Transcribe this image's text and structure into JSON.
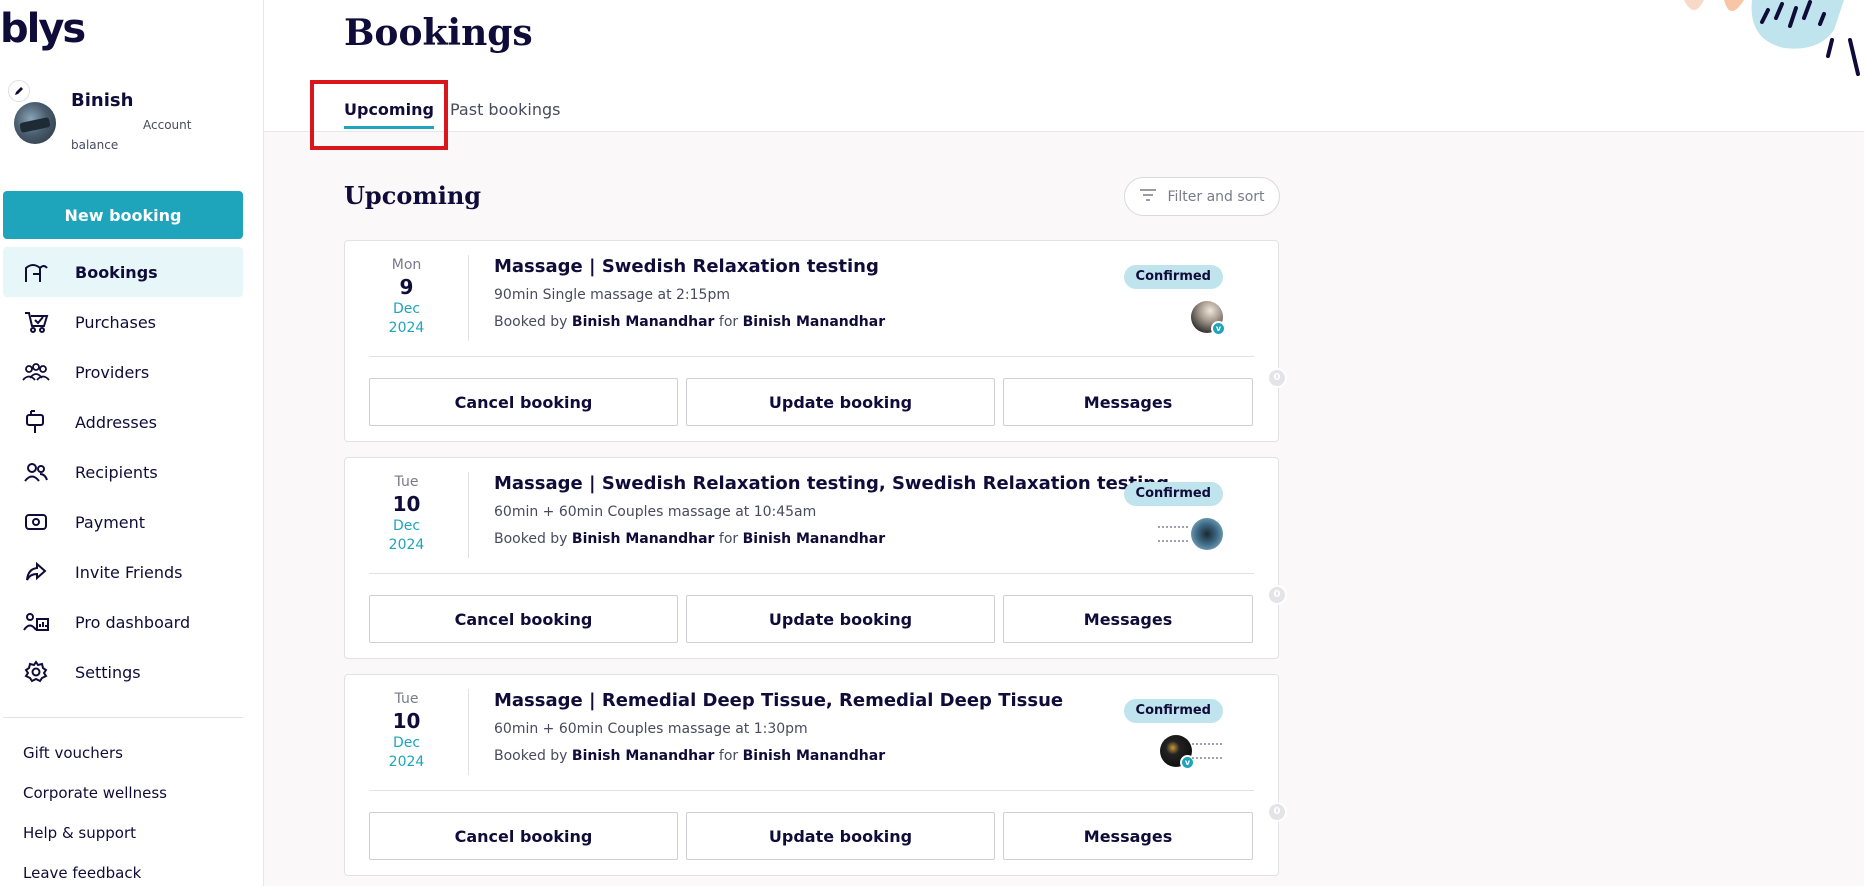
{
  "app": {
    "logo": "blys"
  },
  "profile": {
    "name": "Binish",
    "account_label_1": "Account",
    "account_label_2": "balance"
  },
  "sidebar": {
    "new_booking_label": "New booking",
    "items": [
      {
        "label": "Bookings",
        "icon": "bookings-icon",
        "active": true
      },
      {
        "label": "Purchases",
        "icon": "cart-icon",
        "active": false
      },
      {
        "label": "Providers",
        "icon": "providers-icon",
        "active": false
      },
      {
        "label": "Addresses",
        "icon": "mailbox-icon",
        "active": false
      },
      {
        "label": "Recipients",
        "icon": "recipients-icon",
        "active": false
      },
      {
        "label": "Payment",
        "icon": "payment-icon",
        "active": false
      },
      {
        "label": "Invite Friends",
        "icon": "share-icon",
        "active": false
      },
      {
        "label": "Pro dashboard",
        "icon": "pro-dashboard-icon",
        "active": false
      },
      {
        "label": "Settings",
        "icon": "gear-icon",
        "active": false
      }
    ],
    "footer_links": [
      "Gift vouchers",
      "Corporate wellness",
      "Help & support",
      "Leave feedback"
    ]
  },
  "header": {
    "title": "Bookings",
    "tabs": [
      {
        "label": "Upcoming",
        "active": true
      },
      {
        "label": "Past bookings",
        "active": false
      }
    ]
  },
  "main": {
    "section_title": "Upcoming",
    "filter_label": "Filter and sort",
    "bookings": [
      {
        "dow": "Mon",
        "day": "9",
        "month": "Dec",
        "year": "2024",
        "title": "Massage | Swedish Relaxation testing",
        "subtitle": "90min Single massage at 2:15pm",
        "booked_by_prefix": "Booked by",
        "booked_by": "Binish Manandhar",
        "for_label": "for",
        "recipient": "Binish Manandhar",
        "status": "Confirmed",
        "cancel_label": "Cancel booking",
        "update_label": "Update booking",
        "messages_label": "Messages",
        "message_count": "0"
      },
      {
        "dow": "Tue",
        "day": "10",
        "month": "Dec",
        "year": "2024",
        "title": "Massage | Swedish Relaxation testing, Swedish Relaxation testing",
        "subtitle": "60min + 60min Couples massage at 10:45am",
        "booked_by_prefix": "Booked by",
        "booked_by": "Binish Manandhar",
        "for_label": "for",
        "recipient": "Binish Manandhar",
        "status": "Confirmed",
        "cancel_label": "Cancel booking",
        "update_label": "Update booking",
        "messages_label": "Messages",
        "message_count": "0"
      },
      {
        "dow": "Tue",
        "day": "10",
        "month": "Dec",
        "year": "2024",
        "title": "Massage | Remedial Deep Tissue, Remedial Deep Tissue",
        "subtitle": "60min + 60min Couples massage at 1:30pm",
        "booked_by_prefix": "Booked by",
        "booked_by": "Binish Manandhar",
        "for_label": "for",
        "recipient": "Binish Manandhar",
        "status": "Confirmed",
        "cancel_label": "Cancel booking",
        "update_label": "Update booking",
        "messages_label": "Messages",
        "message_count": "0"
      }
    ]
  },
  "colors": {
    "brand": "#100c39",
    "accent": "#1fa5bb",
    "status_bg": "#bfe4ed",
    "highlight": "#d9161c"
  }
}
